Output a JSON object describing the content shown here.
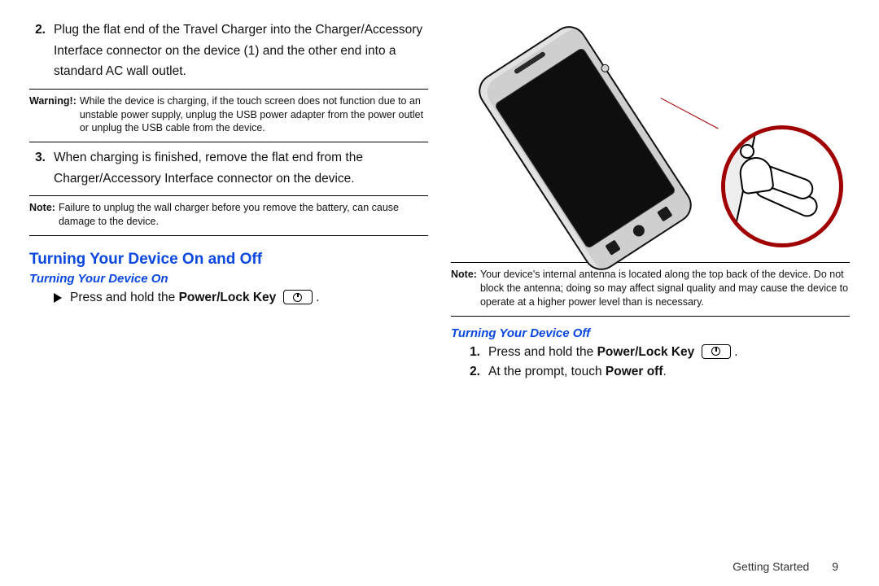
{
  "left": {
    "step2_num": "2.",
    "step2": "Plug the flat end of the Travel Charger into the Charger/Accessory Interface connector on the device (1) and the other end into a standard AC wall outlet.",
    "warn_label": "Warning!:",
    "warn": "While the device is charging, if the touch screen does not function due to an unstable power supply, unplug the USB power adapter from the power outlet or unplug the USB cable from the device.",
    "step3_num": "3.",
    "step3": "When charging is finished, remove the flat end from the Charger/Accessory Interface connector on the device.",
    "note_label": "Note:",
    "note": "Failure to unplug the wall charger before you remove the battery, can cause damage to the device.",
    "h_onoff": "Turning Your Device On and Off",
    "h_on": "Turning Your Device On",
    "on_pre": "Press and hold the ",
    "on_bold": "Power/Lock Key",
    "on_post": " .",
    "pkey_icon": "power-lock-key-icon"
  },
  "right": {
    "note_label": "Note:",
    "note": "Your device's internal antenna is located along the top back of the device. Do not block the antenna; doing so may affect signal quality and may cause the device to operate at a higher power level than is necessary.",
    "h_off": "Turning Your Device Off",
    "s1_num": "1.",
    "s1_pre": "Press and hold the ",
    "s1_bold": "Power/Lock Key",
    "s1_post": " .",
    "s2_num": "2.",
    "s2_pre": "At the prompt, touch ",
    "s2_bold": "Power off",
    "s2_post": "."
  },
  "footer": {
    "section_name": "Getting Started",
    "page": "9"
  }
}
